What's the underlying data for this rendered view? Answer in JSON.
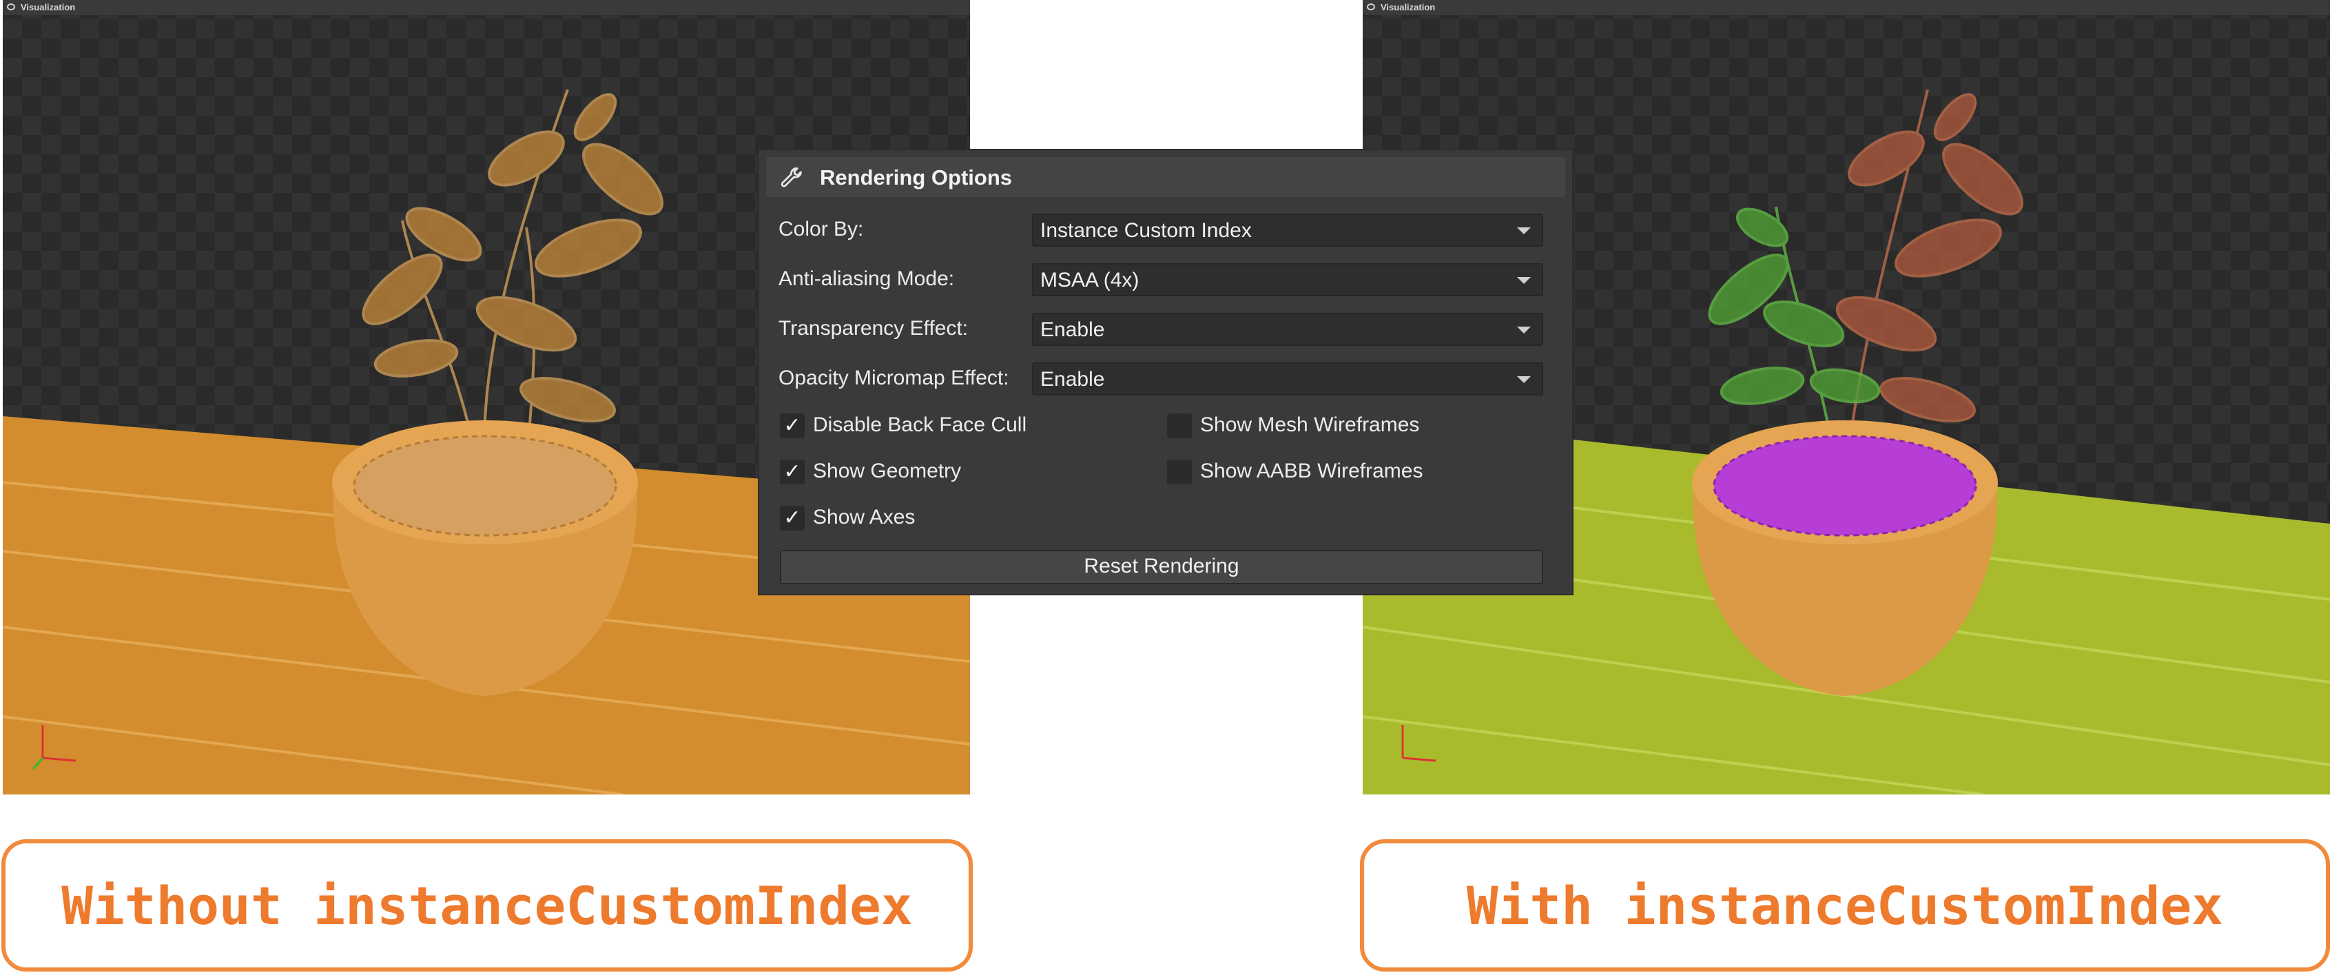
{
  "viewports": [
    {
      "title": "Visualization",
      "floor_color": "#d38d2e",
      "plant_color": "#c88a3a",
      "soil_color": "#d09a52"
    },
    {
      "title": "Visualization",
      "floor_color": "#a9bb2c",
      "plant_color_a": "#4f9f35",
      "plant_color_b": "#b35a3c",
      "soil_color": "#b63ed6"
    }
  ],
  "panel": {
    "title": "Rendering Options",
    "options": [
      {
        "label": "Color By:",
        "value": "Instance Custom Index"
      },
      {
        "label": "Anti-aliasing Mode:",
        "value": "MSAA (4x)"
      },
      {
        "label": "Transparency Effect:",
        "value": "Enable"
      },
      {
        "label": "Opacity Micromap Effect:",
        "value": "Enable"
      }
    ],
    "checkboxes": [
      {
        "label": "Disable Back Face Cull",
        "checked": true
      },
      {
        "label": "Show Mesh Wireframes",
        "checked": false
      },
      {
        "label": "Show Geometry",
        "checked": true
      },
      {
        "label": "Show AABB Wireframes",
        "checked": false
      },
      {
        "label": "Show Axes",
        "checked": true
      }
    ],
    "check_glyph": "✓",
    "reset_label": "Reset Rendering"
  },
  "captions": {
    "left": "Without instanceCustomIndex",
    "right": "With instanceCustomIndex"
  },
  "accent_color": "#ee7a2d"
}
